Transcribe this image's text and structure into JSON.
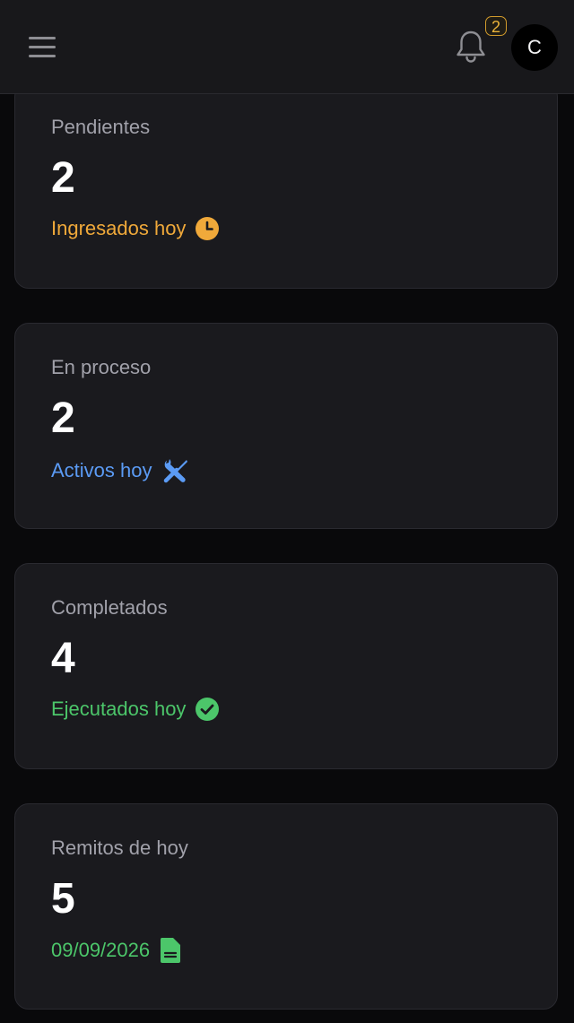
{
  "header": {
    "notification_count": "2",
    "avatar_initial": "C",
    "icons": [
      "menu-icon",
      "bell-icon"
    ]
  },
  "cards": [
    {
      "title": "Pendientes",
      "value": "2",
      "subtitle": "Ingresados hoy",
      "icon": "clock-icon",
      "color": "#f0a93a"
    },
    {
      "title": "En proceso",
      "value": "2",
      "subtitle": "Activos hoy",
      "icon": "tools-icon",
      "color": "#5b9bf5"
    },
    {
      "title": "Completados",
      "value": "4",
      "subtitle": "Ejecutados hoy",
      "icon": "check-circle-icon",
      "color": "#4cc66a"
    },
    {
      "title": "Remitos de hoy",
      "value": "5",
      "subtitle": "09/09/2026",
      "icon": "document-icon",
      "color": "#4cc66a"
    }
  ]
}
